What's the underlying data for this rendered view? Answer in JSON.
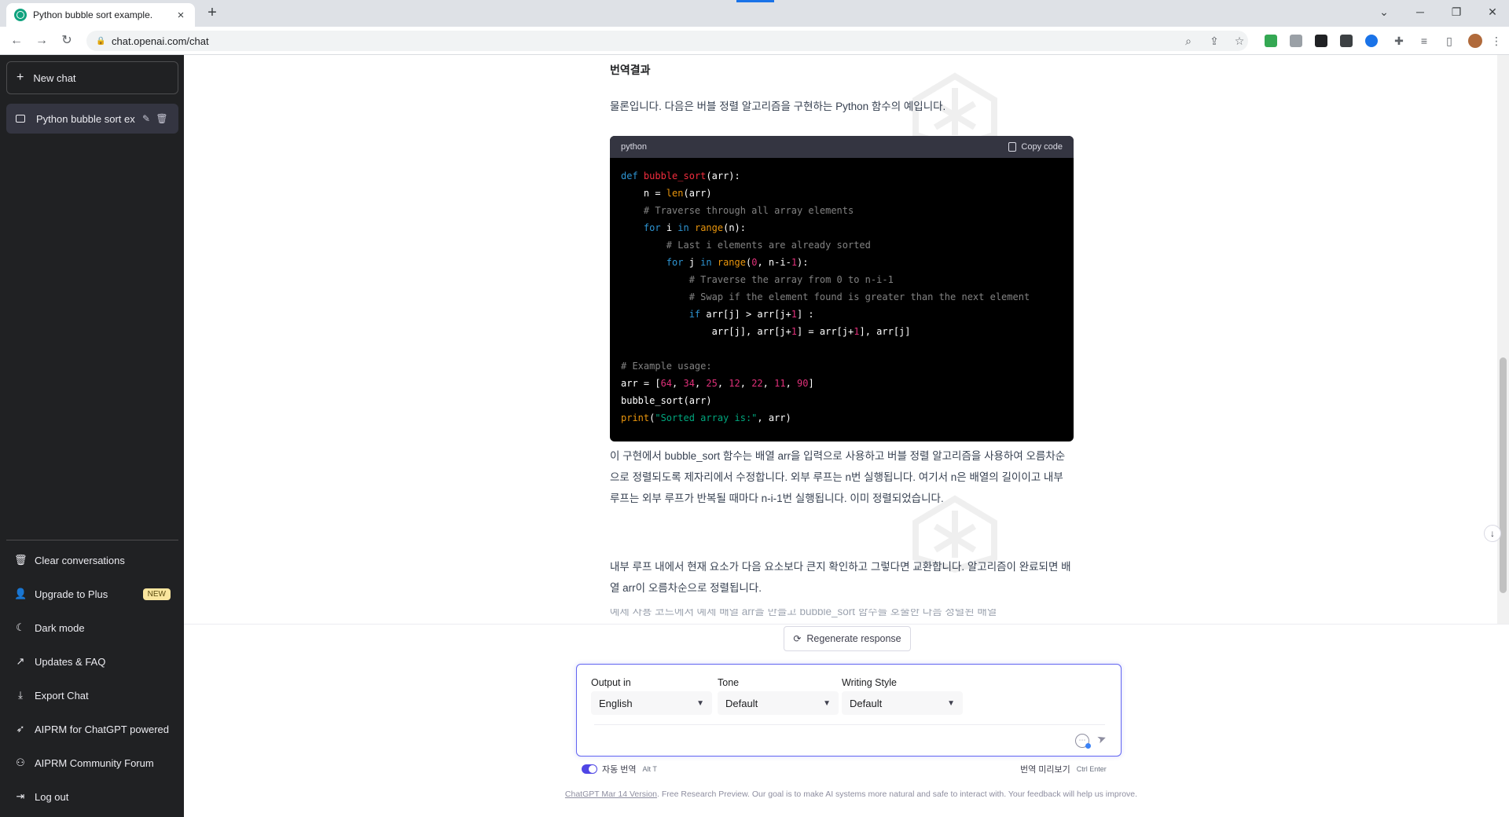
{
  "browser": {
    "tab_title": "Python bubble sort example.",
    "url": "chat.openai.com/chat"
  },
  "sidebar": {
    "new_chat": "New chat",
    "conversation": "Python bubble sort ex",
    "items": [
      {
        "label": "Clear conversations",
        "icon": "trash-icon"
      },
      {
        "label": "Upgrade to Plus",
        "icon": "user-icon",
        "badge": "NEW"
      },
      {
        "label": "Dark mode",
        "icon": "moon-icon"
      },
      {
        "label": "Updates & FAQ",
        "icon": "external-link-icon"
      },
      {
        "label": "Export Chat",
        "icon": "download-icon"
      },
      {
        "label": "AIPRM for ChatGPT powered",
        "icon": "rocket-icon"
      },
      {
        "label": "AIPRM Community Forum",
        "icon": "community-icon"
      },
      {
        "label": "Log out",
        "icon": "logout-icon"
      }
    ]
  },
  "message": {
    "heading": "번역결과",
    "intro": "물론입니다. 다음은 버블 정렬 알고리즘을 구현하는 Python 함수의 예입니다.",
    "code_lang": "python",
    "copy_label": "Copy code",
    "para2": "이 구현에서 bubble_sort 함수는 배열 arr을 입력으로 사용하고 버블 정렬 알고리즘을 사용하여 오름차순으로 정렬되도록 제자리에서 수정합니다. 외부 루프는 n번 실행됩니다. 여기서 n은 배열의 길이이고 내부 루프는 외부 루프가 반복될 때마다 n-i-1번 실행됩니다. 이미 정렬되었습니다.",
    "para3": "내부 루프 내에서 현재 요소가 다음 요소보다 큰지 확인하고 그렇다면 교환합니다. 알고리즘이 완료되면 배열 arr이 오름차순으로 정렬됩니다.",
    "para4": "예제 사용 코드에서 예제 배열 arr을 만들고 bubble_sort 함수를 호출한 다음 정렬된 배열"
  },
  "composer": {
    "regenerate": "Regenerate response",
    "output_label": "Output in",
    "output_value": "English",
    "tone_label": "Tone",
    "tone_value": "Default",
    "style_label": "Writing Style",
    "style_value": "Default",
    "auto_translate": "자동 번역",
    "auto_shortcut": "Alt T",
    "preview": "번역 미리보기",
    "preview_shortcut": "Ctrl Enter"
  },
  "footer": {
    "link": "ChatGPT Mar 14 Version",
    "text": ". Free Research Preview. Our goal is to make AI systems more natural and safe to interact with. Your feedback will help us improve."
  },
  "colors": {
    "sidebar_bg": "#202123",
    "accent": "#6366f1",
    "code_bg": "#000000"
  }
}
